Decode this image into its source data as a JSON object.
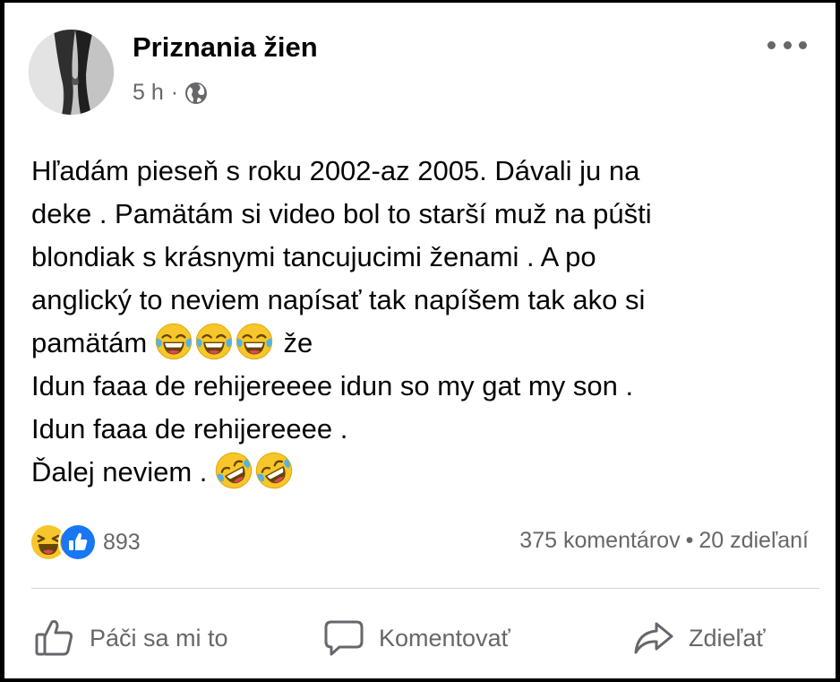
{
  "post": {
    "page_name": "Priznania žien",
    "time": "5 h",
    "separator": "·",
    "audience_icon": "globe-icon",
    "more_icon": "more-horizontal-icon",
    "text_lines": [
      "Hľadám pieseň s roku 2002-az 2005. Dávali ju na",
      "deke . Pamätám si video bol to starší muž na púšti",
      "blondiak s krásnymi tancujucimi ženami . A po",
      "anglický to neviem napísať tak napíšem tak ako si",
      "pamätám",
      "že",
      "Idun faaa de rehijereeee idun so my gat my son .",
      "Idun faaa de rehijereeee .",
      "Ďalej neviem ."
    ],
    "emojis": [
      "face-with-tears-of-joy",
      "rolling-on-the-floor-laughing"
    ]
  },
  "reactions": {
    "icons": [
      "haha-reaction-icon",
      "like-reaction-icon"
    ],
    "count": "893"
  },
  "stats": {
    "comments": "375 komentárov",
    "separator": "•",
    "shares": "20 zdieľaní"
  },
  "actions": {
    "like_label": "Páči sa mi to",
    "comment_label": "Komentovať",
    "share_label": "Zdieľať"
  },
  "colors": {
    "text": "#050505",
    "secondary_text": "#65676b",
    "like_blue": "#1877f2",
    "emoji_yellow": "#f7c62a"
  }
}
